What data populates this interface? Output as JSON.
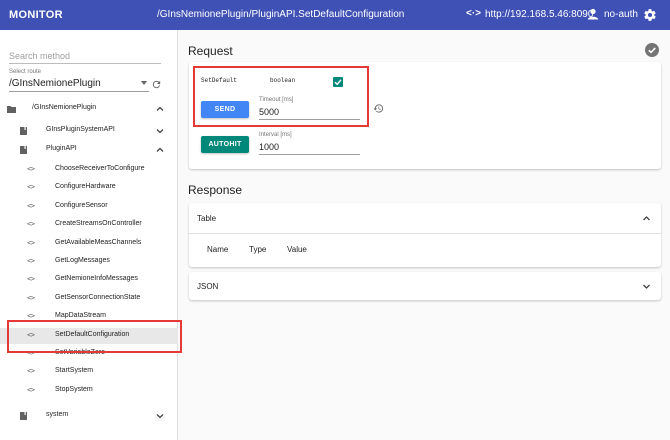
{
  "header": {
    "app_title": "MONITOR",
    "route_path": "/GInsNemionePlugin/PluginAPI.SetDefaultConfiguration",
    "connection_icon": "<·>",
    "connection_url": "http://192.168.5.46:8090",
    "user_label": "no-auth"
  },
  "sidebar": {
    "search_placeholder": "Search method",
    "route_label": "Select route",
    "route_value": "/GInsNemionePlugin",
    "tree": [
      {
        "label": "/GInsNemionePlugin",
        "icon": "folder-icon",
        "expanded": true
      },
      {
        "label": "GInsPluginSystemAPI",
        "icon": "book-icon",
        "expanded": false
      },
      {
        "label": "PluginAPI",
        "icon": "book-icon",
        "expanded": true
      },
      {
        "label": "system",
        "icon": "book-icon",
        "expanded": false
      }
    ],
    "methods": [
      "ChooseReceiverToConfigure",
      "ConfigureHardware",
      "ConfigureSensor",
      "CreateStreamsOnController",
      "GetAvailableMeasChannels",
      "GetLogMessages",
      "GetNemioneInfoMessages",
      "GetSensorConnectionState",
      "MapDataStream",
      "SetDefaultConfiguration",
      "SetVariableZero",
      "StartSystem",
      "StopSystem"
    ],
    "method_icon": "<>",
    "selected_method": "SetDefaultConfiguration"
  },
  "request": {
    "title": "Request",
    "param_name": "SetDefault",
    "param_type": "boolean",
    "param_checked": true,
    "send_label": "SEND",
    "timeout_label": "Timeout [ms]",
    "timeout_value": "5000",
    "autohit_label": "AUTOHIT",
    "interval_label": "Interval [ms]",
    "interval_value": "1000"
  },
  "response": {
    "title": "Response",
    "table_panel_title": "Table",
    "columns": [
      "Name",
      "Type",
      "Value"
    ],
    "json_panel_title": "JSON"
  },
  "colors": {
    "header_bg": "#3f51b5",
    "send_button": "#4285f4",
    "autohit_button": "#00897b",
    "highlight_box": "#e53935"
  }
}
